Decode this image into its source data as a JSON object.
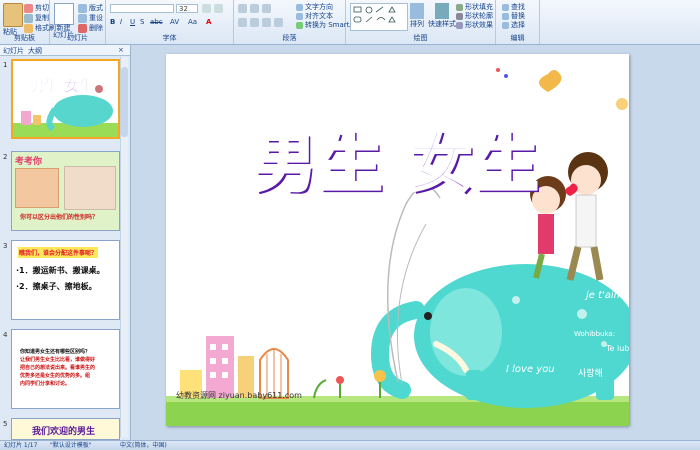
{
  "ribbon": {
    "clipboard": {
      "label": "剪贴板",
      "cut": "剪切",
      "copy": "复制",
      "format_painter": "格式刷",
      "paste": "粘贴"
    },
    "slides": {
      "label": "幻灯片",
      "new_slide": "新建\n幻灯片",
      "layout": "版式",
      "reset": "重设",
      "delete": "删除"
    },
    "font": {
      "label": "字体",
      "font_name": "",
      "font_size": "32"
    },
    "paragraph": {
      "label": "段落",
      "text_direction": "文字方向",
      "align_text": "对齐文本",
      "smartart": "转换为 SmartArt"
    },
    "drawing": {
      "label": "绘图",
      "arrange": "排列",
      "quick_styles": "快速样式",
      "shape_fill": "形状填充",
      "shape_outline": "形状轮廓",
      "shape_effects": "形状效果"
    },
    "editing": {
      "label": "编辑",
      "find": "查找",
      "replace": "替换",
      "select": "选择"
    }
  },
  "sidebar": {
    "tab_slides": "幻灯片",
    "tab_outline": "大纲",
    "thumbs": [
      {
        "num": "1",
        "title": "男生 女生"
      },
      {
        "num": "2",
        "title": "考考你",
        "caption": "你可以区分出他们的性别吗？"
      },
      {
        "num": "3",
        "title": "瞧我们，谁会分配这件事呢？",
        "lines": [
          "·1．搬运新书、搬课桌。",
          "·2．擦桌子、擦地板。"
        ]
      },
      {
        "num": "4",
        "lines": [
          "你知道男女生还有哪些区别吗？",
          "让我们男生女生比比看，谁做得好",
          "把自己的想法说出来。看谁男生的",
          "优势多还是女生的优势的多。组",
          "内同学们分享和讨论。"
        ]
      },
      {
        "num": "5",
        "title": "我们欢迎的男生"
      }
    ]
  },
  "slide": {
    "title": "男生 女生",
    "watermark": "幼教资源网 ziyuan.baby611.com",
    "deco_text": [
      "je t'aime",
      "Te iubesc",
      "I love you",
      "사랑해",
      "Wohibbuka:"
    ]
  },
  "status": {
    "slide_info": "幻灯片 1/17",
    "theme": "\"默认设计模板\"",
    "language": "中文(简体，中国)"
  },
  "colors": {
    "title_fill": "#7a2fe0",
    "elephant": "#4fd8d0",
    "grass": "#8cd34f"
  }
}
